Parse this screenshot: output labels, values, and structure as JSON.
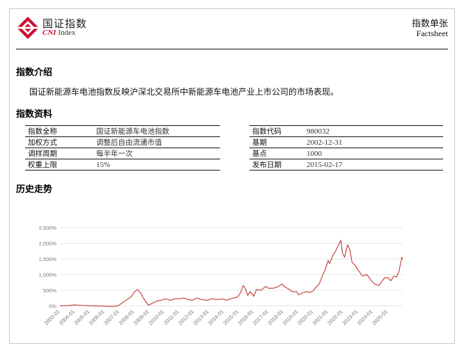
{
  "header": {
    "logo_cn": "国证指数",
    "logo_en_prefix": "CNI",
    "logo_en_suffix": " Index",
    "doc_type_cn": "指数单张",
    "doc_type_en": "Factsheet"
  },
  "intro": {
    "title": "指数介绍",
    "text": "国证新能源车电池指数反映沪深北交易所中新能源车电池产业上市公司的市场表现。"
  },
  "info": {
    "title": "指数资料",
    "left": [
      {
        "key": "指数全称",
        "value": "国证新能源车电池指数"
      },
      {
        "key": "加权方式",
        "value": "调整后自由流通市值"
      },
      {
        "key": "调样周期",
        "value": "每半年一次"
      },
      {
        "key": "权重上限",
        "value": "15%"
      }
    ],
    "right": [
      {
        "key": "指数代码",
        "value": "980032"
      },
      {
        "key": "基期",
        "value": "2002-12-31"
      },
      {
        "key": "基点",
        "value": "1000"
      },
      {
        "key": "发布日期",
        "value": "2015-02-17"
      }
    ]
  },
  "history": {
    "title": "历史走势"
  },
  "colors": {
    "accent": "#c8102e",
    "line": "#c0392b",
    "grid": "#e6e6e6"
  },
  "chart_data": {
    "type": "line",
    "title": "",
    "xlabel": "",
    "ylabel": "",
    "ylim": [
      -80,
      2500
    ],
    "y_ticks": [
      0,
      500,
      1000,
      1500,
      2000,
      2500
    ],
    "y_tick_labels": [
      "0%",
      "500%",
      "1,000%",
      "1,500%",
      "2,000%",
      "2,500%"
    ],
    "x_tick_labels": [
      "2003-01",
      "2004-01",
      "2005-01",
      "2006-01",
      "2007-01",
      "2008-01",
      "2009-01",
      "2010-01",
      "2011-01",
      "2012-01",
      "2013-01",
      "2014-01",
      "2015-01",
      "2016-01",
      "2017-01",
      "2018-01",
      "2019-01",
      "2020-01",
      "2021-01",
      "2022-01",
      "2023-01",
      "2024-01",
      "2025-01"
    ],
    "grid": true,
    "series": [
      {
        "values_note": "cumulative return %",
        "x": [
          2003.0,
          2003.5,
          2004.0,
          2004.3,
          2004.6,
          2005.0,
          2005.5,
          2006.0,
          2006.5,
          2006.9,
          2007.2,
          2007.5,
          2007.8,
          2008.0,
          2008.2,
          2008.4,
          2008.6,
          2008.8,
          2008.95,
          2009.2,
          2009.5,
          2009.8,
          2010.1,
          2010.4,
          2010.8,
          2011.0,
          2011.3,
          2011.6,
          2011.9,
          2012.2,
          2012.5,
          2012.9,
          2013.2,
          2013.5,
          2013.9,
          2014.2,
          2014.5,
          2014.9,
          2015.1,
          2015.3,
          2015.45,
          2015.6,
          2015.75,
          2015.9,
          2016.0,
          2016.2,
          2016.5,
          2016.8,
          2017.0,
          2017.3,
          2017.6,
          2017.9,
          2018.1,
          2018.3,
          2018.6,
          2018.9,
          2019.0,
          2019.2,
          2019.5,
          2019.8,
          2020.0,
          2020.2,
          2020.4,
          2020.6,
          2020.8,
          2021.0,
          2021.1,
          2021.3,
          2021.5,
          2021.7,
          2021.85,
          2021.95,
          2022.1,
          2022.3,
          2022.45,
          2022.6,
          2022.8,
          2023.0,
          2023.3,
          2023.6,
          2023.9,
          2024.1,
          2024.4,
          2024.6,
          2024.8,
          2025.0,
          2025.2,
          2025.4,
          2025.6,
          2025.75,
          2025.85,
          2025.95,
          2026.0
        ],
        "y": [
          0,
          5,
          30,
          20,
          10,
          0,
          -5,
          -10,
          -20,
          -5,
          100,
          200,
          300,
          450,
          520,
          420,
          250,
          100,
          20,
          80,
          150,
          180,
          220,
          180,
          230,
          220,
          250,
          200,
          180,
          250,
          200,
          180,
          230,
          200,
          220,
          180,
          230,
          280,
          400,
          650,
          550,
          330,
          450,
          380,
          300,
          520,
          500,
          620,
          560,
          560,
          600,
          700,
          600,
          550,
          450,
          450,
          350,
          400,
          450,
          430,
          480,
          600,
          700,
          950,
          1150,
          1450,
          1350,
          1600,
          1750,
          1950,
          2100,
          1700,
          1550,
          1950,
          1800,
          1400,
          1300,
          1150,
          950,
          1000,
          800,
          700,
          650,
          780,
          900,
          900,
          800,
          950,
          920,
          1100,
          1350,
          1550,
          1500
        ]
      }
    ]
  }
}
